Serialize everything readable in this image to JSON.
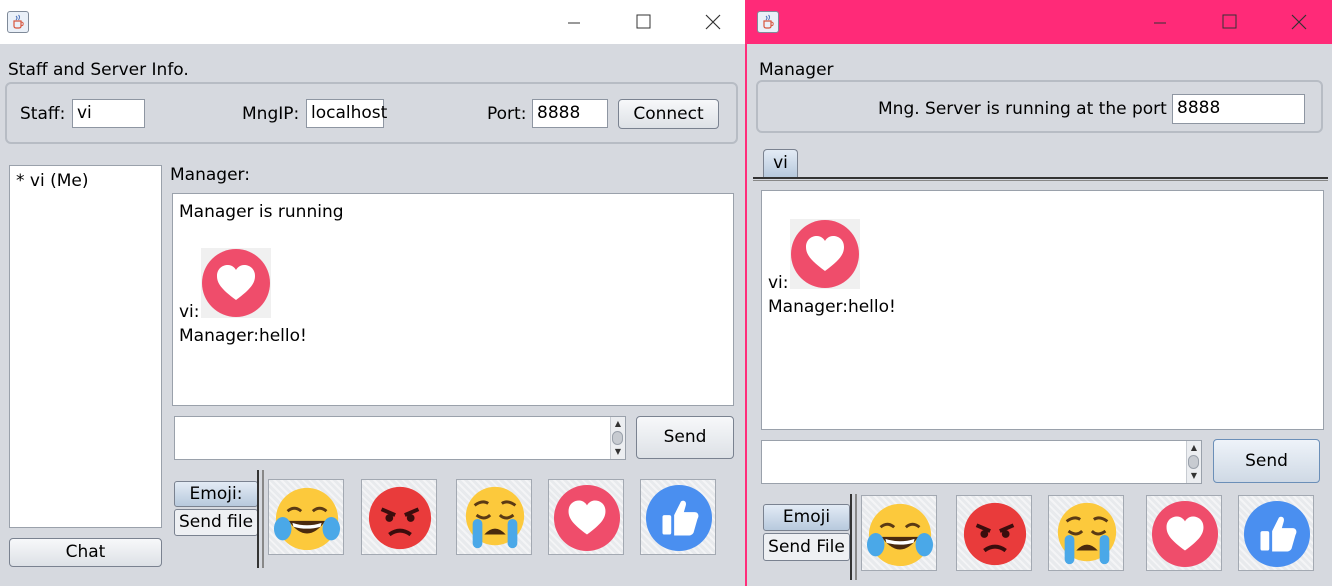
{
  "staff": {
    "group_title": "Staff and Server Info.",
    "staff_label": "Staff:",
    "staff_value": "vi",
    "mngip_label": "MngIP:",
    "mngip_value": "localhost",
    "port_label": "Port:",
    "port_value": "8888",
    "connect_label": "Connect",
    "user_list": [
      "* vi (Me)"
    ],
    "chat_button": "Chat",
    "manager_label": "Manager:",
    "messages": {
      "line1": "Manager is running",
      "line2_prefix": "vi:",
      "line3": "Manager:hello!"
    },
    "send_label": "Send",
    "emoji_tab": "Emoji:",
    "sendfile_tab": "Send file"
  },
  "manager": {
    "group_title": "Manager",
    "running_label": "Mng. Server is running at the port",
    "port_value": "8888",
    "client_tab": "vi",
    "messages": {
      "line1_prefix": "vi:",
      "line2": "Manager:hello!"
    },
    "send_label": "Send",
    "emoji_tab": "Emoji",
    "sendfile_tab": "Send File"
  },
  "emojis": [
    "laughing-crying-icon",
    "angry-face-icon",
    "sad-crying-icon",
    "heart-icon",
    "thumbs-up-icon"
  ],
  "colors": {
    "manager_titlebar": "#ff2a78",
    "heart_red": "#f0506e",
    "like_blue": "#4a8ff0"
  }
}
